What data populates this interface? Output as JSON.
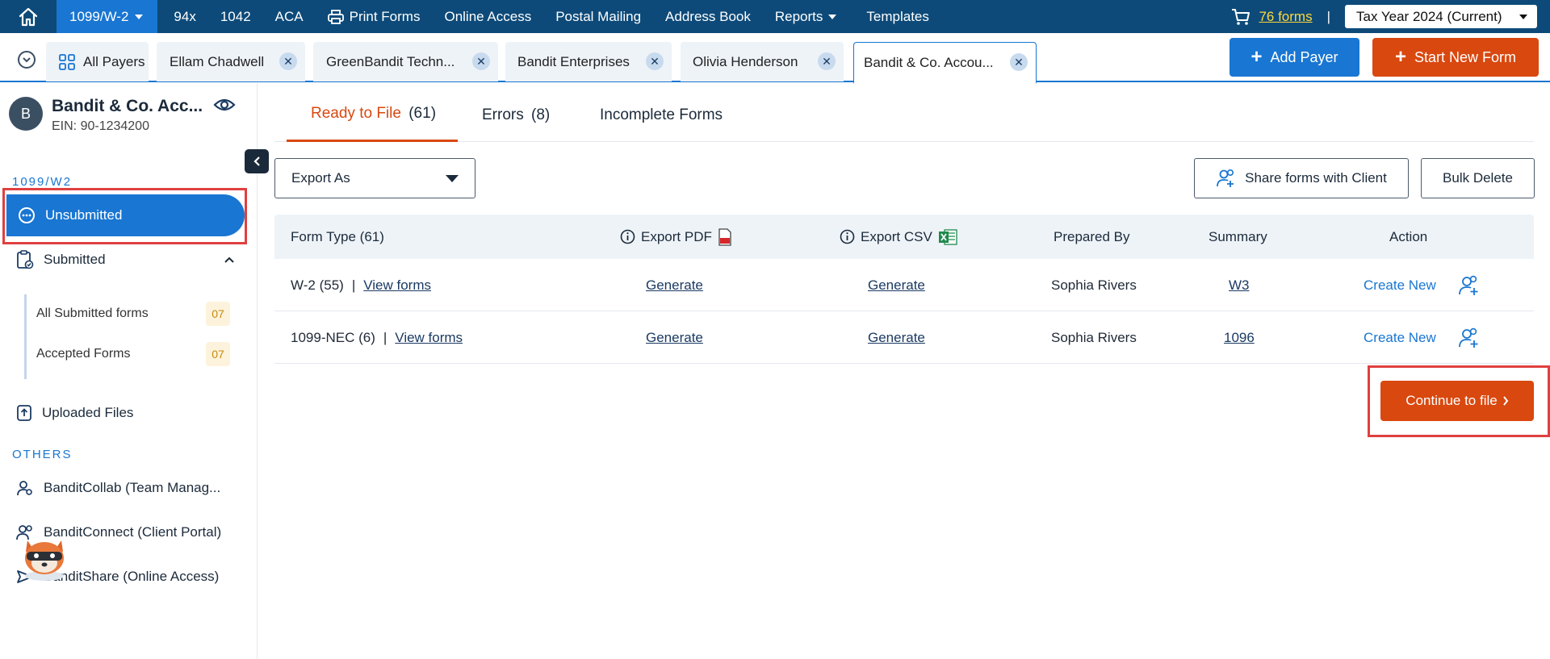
{
  "topnav": {
    "home_icon": "home-icon",
    "active_menu": "1099/W-2",
    "items": [
      "94x",
      "1042",
      "ACA",
      "Print Forms",
      "Online Access",
      "Postal Mailing",
      "Address Book",
      "Reports",
      "Templates"
    ],
    "cart_label": "76 forms",
    "separator": "|",
    "tax_year": "Tax Year 2024 (Current)"
  },
  "tabs": {
    "all_payers": "All Payers",
    "items": [
      "Ellam Chadwell",
      "GreenBandit Techn...",
      "Bandit Enterprises",
      "Olivia Henderson",
      "Bandit & Co. Accou..."
    ],
    "close_glyph": "✕"
  },
  "actions": {
    "add_payer": "Add Payer",
    "start_new_form": "Start New Form"
  },
  "sidebar": {
    "avatar_initial": "B",
    "payer_name": "Bandit & Co. Acc...",
    "ein": "EIN: 90-1234200",
    "section_1099": "1099/W2",
    "unsubmitted": "Unsubmitted",
    "submitted": "Submitted",
    "all_submitted": "All Submitted forms",
    "all_submitted_count": "07",
    "accepted": "Accepted Forms",
    "accepted_count": "07",
    "uploaded_files": "Uploaded Files",
    "section_others": "OTHERS",
    "bandit_collab": "BanditCollab (Team Manag...",
    "bandit_connect": "BanditConnect (Client Portal)",
    "bandit_share": "BanditShare (Online Access)"
  },
  "main": {
    "tab_ready": "Ready to File",
    "tab_ready_count": "(61)",
    "tab_errors": "Errors",
    "tab_errors_count": "(8)",
    "tab_incomplete": "Incomplete Forms",
    "export_as": "Export As",
    "share_forms": "Share forms with Client",
    "bulk_delete": "Bulk Delete",
    "continue": "Continue to file"
  },
  "table": {
    "headers": {
      "form_type": "Form Type  (61)",
      "export_pdf": "Export PDF",
      "export_csv": "Export CSV",
      "prepared_by": "Prepared By",
      "summary": "Summary",
      "action": "Action"
    },
    "rows": [
      {
        "form": "W-2 (55)",
        "sep": "|",
        "view": "View forms",
        "pdf": "Generate",
        "csv": "Generate",
        "prepared_by": "Sophia Rivers",
        "summary": "W3",
        "action": "Create New"
      },
      {
        "form": "1099-NEC (6)",
        "sep": "|",
        "view": "View forms",
        "pdf": "Generate",
        "csv": "Generate",
        "prepared_by": "Sophia Rivers",
        "summary": "1096",
        "action": "Create New"
      }
    ]
  },
  "colors": {
    "nav_bg": "#0d4a79",
    "primary": "#1976d2",
    "accent": "#d9480f",
    "highlight_red": "#e04040"
  }
}
